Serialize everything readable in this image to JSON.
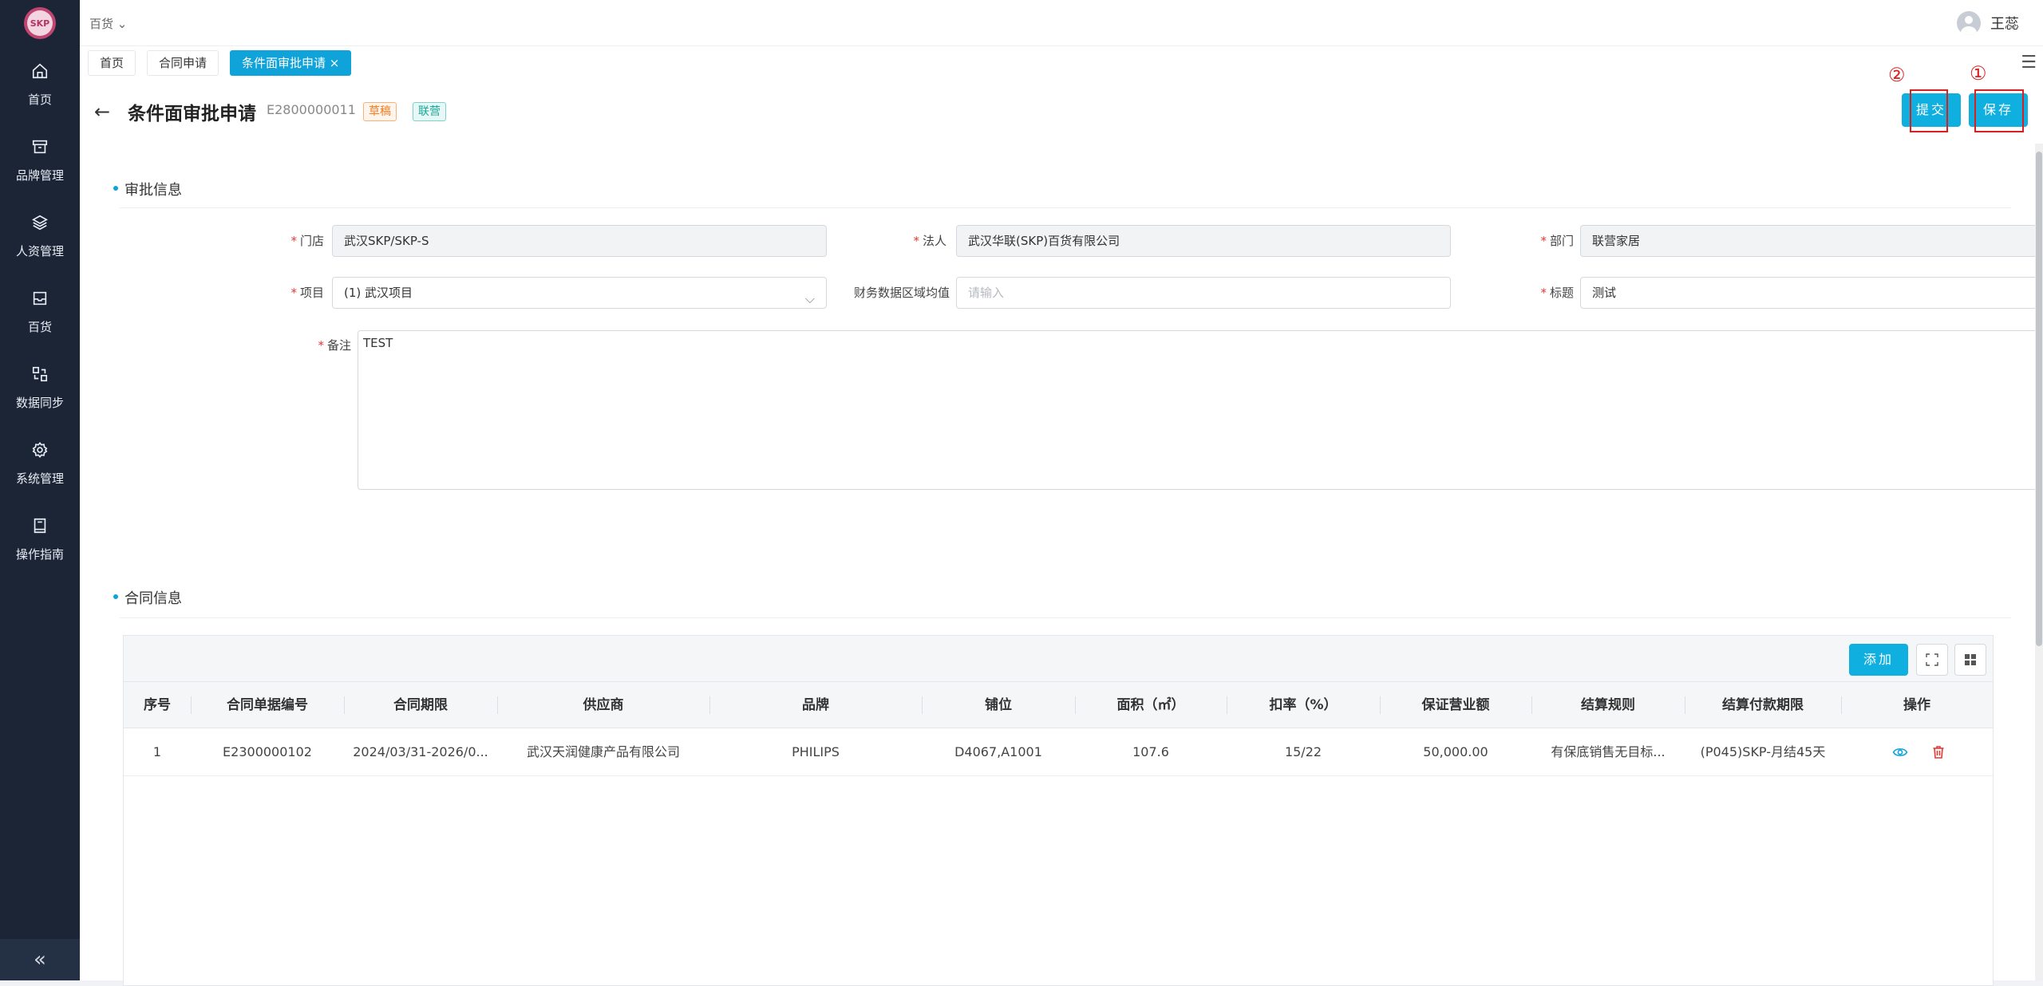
{
  "sidebar": {
    "logo_text": "SKP",
    "items": [
      {
        "label": "首页",
        "icon": "home-icon"
      },
      {
        "label": "品牌管理",
        "icon": "archive-icon"
      },
      {
        "label": "人资管理",
        "icon": "layers-icon"
      },
      {
        "label": "百货",
        "icon": "inbox-icon"
      },
      {
        "label": "数据同步",
        "icon": "sync-icon"
      },
      {
        "label": "系统管理",
        "icon": "gear-icon"
      },
      {
        "label": "操作指南",
        "icon": "book-icon"
      }
    ],
    "collapse": "«"
  },
  "topbar": {
    "store": "百货",
    "user_name": "王蕊"
  },
  "tabs": [
    {
      "label": "首页"
    },
    {
      "label": "合同申请"
    },
    {
      "label": "条件面审批申请",
      "close": "×"
    }
  ],
  "header": {
    "back": "←",
    "title": "条件面审批申请",
    "doc_no": "E2800000011",
    "status_badge": "草稿",
    "type_badge": "联营",
    "submit_label": "提交",
    "save_label": "保存",
    "marker_1": "①",
    "marker_2": "②"
  },
  "approval": {
    "section_title": "审批信息",
    "store_label": "门店",
    "store_value": "武汉SKP/SKP-S",
    "legal_label": "法人",
    "legal_value": "武汉华联(SKP)百货有限公司",
    "dept_label": "部门",
    "dept_value": "联营家居",
    "project_label": "项目",
    "project_value": "(1) 武汉项目",
    "finance_label": "财务数据区域均值",
    "finance_placeholder": "请输入",
    "subject_label": "标题",
    "subject_value": "测试",
    "remark_label": "备注",
    "remark_value": "TEST",
    "required_mark": "*"
  },
  "contract": {
    "section_title": "合同信息",
    "add_label": "添加",
    "columns": [
      "序号",
      "合同单据编号",
      "合同期限",
      "供应商",
      "品牌",
      "铺位",
      "面积（㎡）",
      "扣率（%）",
      "保证营业额",
      "结算规则",
      "结算付款期限",
      "操作"
    ],
    "rows": [
      {
        "index": "1",
        "contract_no": "E2300000102",
        "period": "2024/03/31-2026/0...",
        "supplier": "武汉天润健康产品有限公司",
        "brand": "PHILIPS",
        "stall": "D4067,A1001",
        "area": "107.6",
        "rate": "15/22",
        "guarantee": "50,000.00",
        "rule": "有保底销售无目标...",
        "payment": "(P045)SKP-月结45天"
      }
    ]
  },
  "colors": {
    "sidebar": "#1b2536",
    "accent": "#0fb0e0",
    "annotation": "#d82020"
  }
}
